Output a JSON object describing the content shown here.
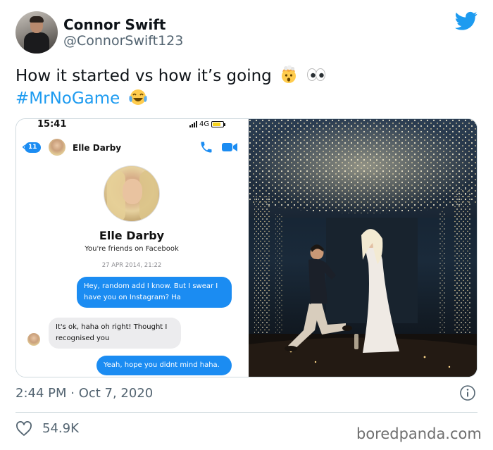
{
  "tweet": {
    "author_name": "Connor Swift",
    "author_handle": "@ConnorSwift123",
    "text_line1": "How it started  vs how it’s going",
    "hashtag": "#MrNoGame",
    "emojis_line1": [
      "exploding-head-emoji",
      "eyes-emoji"
    ],
    "emojis_line2": [
      "tears-of-joy-emoji"
    ],
    "timestamp": "2:44 PM · Oct 7, 2020",
    "likes": "54.9K"
  },
  "screenshot": {
    "status_time": "15:41",
    "network": "4G",
    "back_badge": "11",
    "contact_name": "Elle Darby",
    "profile_name": "Elle Darby",
    "profile_subtitle": "You're friends on Facebook",
    "date_separator": "27 APR 2014, 21:22",
    "messages": [
      {
        "direction": "outgoing",
        "text": "Hey, random add I know. But I swear I have you on Instagram? Ha"
      },
      {
        "direction": "incoming",
        "text": "It's ok, haha oh right! Thought I recognised you"
      },
      {
        "direction": "outgoing",
        "text": "Yeah, hope you didnt mind haha."
      }
    ]
  },
  "colors": {
    "twitter_blue": "#1d9bf0",
    "messenger_blue": "#1b8cf2",
    "secondary_text": "#536471"
  },
  "icons": [
    "twitter-bird-icon",
    "phone-icon",
    "video-camera-icon",
    "info-icon",
    "heart-icon"
  ],
  "watermark": "boredpanda.com"
}
